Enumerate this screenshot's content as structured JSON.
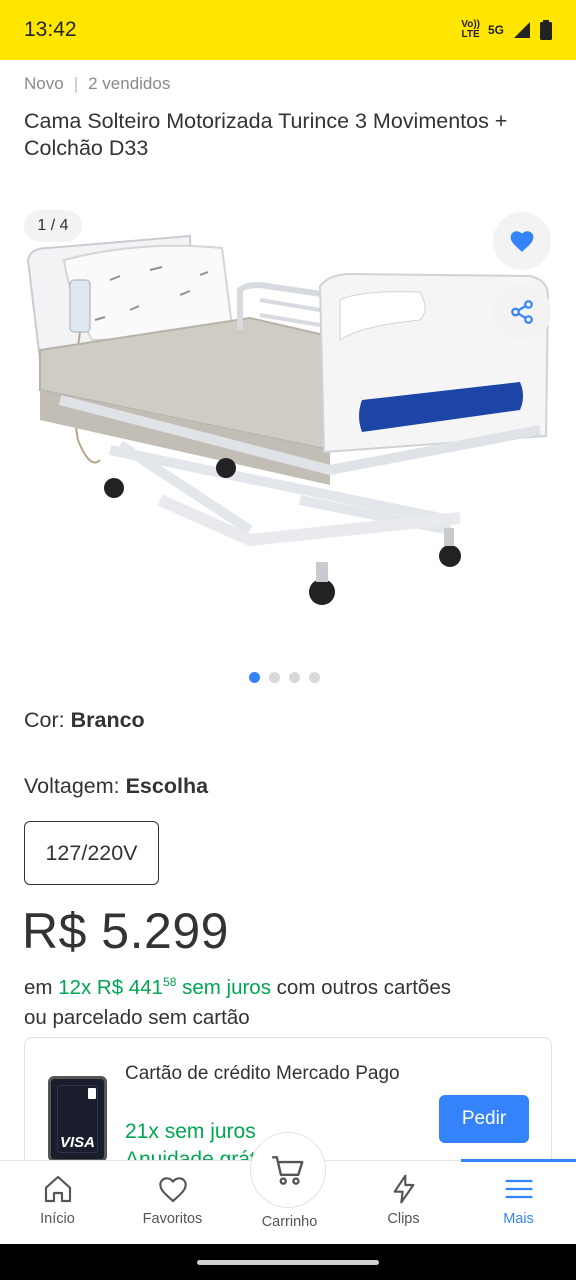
{
  "status_bar": {
    "time": "13:42",
    "network_top": "Vo))",
    "network_bottom": "LTE",
    "network_5g": "5G"
  },
  "product": {
    "condition": "Novo",
    "sold": "2 vendidos",
    "title": "Cama Solteiro Motorizada Turince 3 Movimentos + Colchão D33"
  },
  "gallery": {
    "counter": "1 / 4",
    "current_index": 1,
    "total": 4
  },
  "attributes": {
    "color_label": "Cor: ",
    "color_value": "Branco",
    "voltage_label": "Voltagem: ",
    "voltage_value": "Escolha",
    "voltage_option": "127/220V"
  },
  "price": {
    "value": "R$ 5.299",
    "inst_prefix": "em ",
    "inst_count": "12x R$ 441",
    "inst_cents": "58",
    "inst_interest": " sem juros",
    "inst_suffix": " com outros cartões",
    "inst_line2": "ou parcelado sem cartão"
  },
  "offer": {
    "title": "Cartão de crédito Mercado Pago",
    "sub1": "21x sem juros",
    "sub2": "Anuidade grátis",
    "card_brand": "VISA",
    "button": "Pedir"
  },
  "nav": {
    "inicio": "Início",
    "favoritos": "Favoritos",
    "carrinho": "Carrinho",
    "clips": "Clips",
    "mais": "Mais"
  },
  "colors": {
    "brand_yellow": "#ffe600",
    "accent_blue": "#3483fa",
    "green": "#00a650"
  }
}
